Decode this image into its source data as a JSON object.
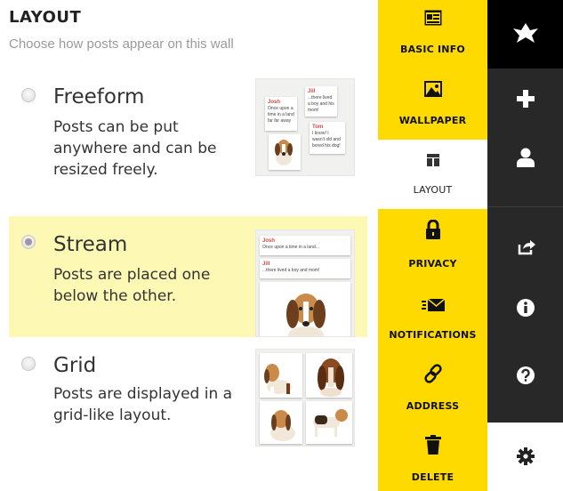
{
  "layout": {
    "title": "LAYOUT",
    "subtitle": "Choose how posts appear on this wall",
    "selected": "stream",
    "options": [
      {
        "id": "freeform",
        "name": "Freeform",
        "description": "Posts can be put anywhere and can be resized freely.",
        "thumb_cards": [
          {
            "author": "Josh",
            "text": "Once upon a time in a land far far away"
          },
          {
            "author": "Jill",
            "text": "...there lived a boy and his mom!"
          },
          {
            "author": "Tom",
            "text": "I know! I wasn't old and bored his dog!"
          }
        ]
      },
      {
        "id": "stream",
        "name": "Stream",
        "description": "Posts are placed one below the other.",
        "thumb_cards": [
          {
            "author": "Josh",
            "text": "Once upon a time in a land..."
          },
          {
            "author": "Jill",
            "text": "...there lived a boy and mom!"
          }
        ]
      },
      {
        "id": "grid",
        "name": "Grid",
        "description": "Posts are displayed in a grid-like layout.",
        "thumb_cards": []
      }
    ]
  },
  "nav": {
    "active": "layout",
    "items": [
      {
        "id": "basic-info",
        "label": "BASIC INFO",
        "icon": "id-card-icon"
      },
      {
        "id": "wallpaper",
        "label": "WALLPAPER",
        "icon": "image-icon"
      },
      {
        "id": "layout",
        "label": "LAYOUT",
        "icon": "layout-columns-icon"
      },
      {
        "id": "privacy",
        "label": "PRIVACY",
        "icon": "lock-icon"
      },
      {
        "id": "notifications",
        "label": "NOTIFICATIONS",
        "icon": "email-icon"
      },
      {
        "id": "address",
        "label": "ADDRESS",
        "icon": "link-icon"
      },
      {
        "id": "delete",
        "label": "DELETE",
        "icon": "trash-icon"
      }
    ]
  },
  "toolbar": {
    "items": [
      {
        "id": "logo",
        "icon": "padlet-logo-icon"
      },
      {
        "id": "add",
        "icon": "plus-icon"
      },
      {
        "id": "profile",
        "icon": "user-icon"
      },
      {
        "id": "share",
        "icon": "share-icon"
      },
      {
        "id": "info",
        "icon": "info-icon"
      },
      {
        "id": "help",
        "icon": "help-icon"
      },
      {
        "id": "settings",
        "icon": "gear-icon"
      }
    ]
  },
  "colors": {
    "nav_bg": "#ffda00",
    "toolbar_bg": "#282828",
    "selected_option_bg": "#fdf9b5",
    "author_red": "#d64a43"
  }
}
